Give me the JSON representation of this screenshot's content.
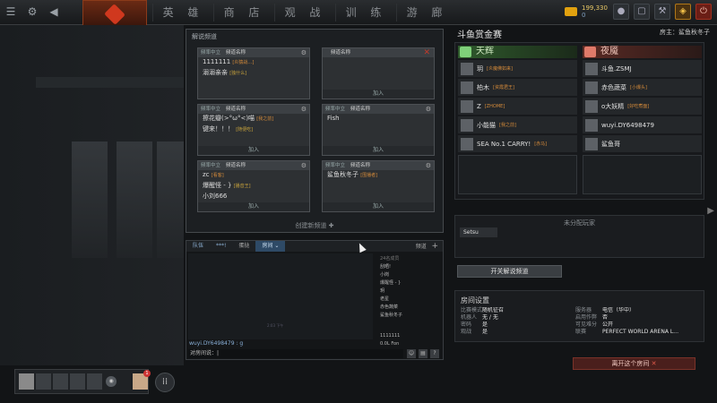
{
  "nav": {
    "items": [
      "英 雄",
      "商 店",
      "观 战",
      "训 练",
      "游 廊"
    ]
  },
  "top": {
    "gold": "199,330",
    "gold_sub": "0"
  },
  "channels": {
    "title": "解说频道",
    "create_label": "创建新频道",
    "cards": [
      {
        "hd1": "频率中立",
        "hd2": "频道名称",
        "lines": [
          {
            "text": "1111111",
            "tag": "[炎猿战…]"
          },
          {
            "text": "溺溺亲亲",
            "tag": "[独什么]"
          }
        ],
        "join": "",
        "icon": "gear"
      },
      {
        "hd1": "",
        "hd2": "频道名称",
        "lines": [],
        "join": "加入",
        "icon": "x"
      },
      {
        "hd1": "频率中立",
        "hd2": "频道名称",
        "lines": [
          {
            "text": "擦花瓣(>°ω°<)喵",
            "tag": "[我之前]"
          },
          {
            "text": "键来！！！",
            "tag": "[随便吃]"
          }
        ],
        "join": "加入",
        "icon": "gear"
      },
      {
        "hd1": "频率中立",
        "hd2": "频道名称",
        "lines": [
          {
            "text": "Fish",
            "tag": ""
          }
        ],
        "join": "加入",
        "icon": "gear"
      },
      {
        "hd1": "频率中立",
        "hd2": "频道名称",
        "lines": [
          {
            "text": "zc",
            "tag": "[看客]"
          },
          {
            "text": "爆醒怪 - }",
            "tag": "[播音王]"
          },
          {
            "text": "小刘666",
            "tag": ""
          }
        ],
        "join": "加入",
        "icon": "gear"
      },
      {
        "hd1": "频率中立",
        "hd2": "频道名称",
        "lines": [
          {
            "text": "鲨鱼秋冬子",
            "tag": "[围播者]"
          }
        ],
        "join": "加入",
        "icon": "gear"
      }
    ]
  },
  "chat": {
    "tabs": [
      "队伍",
      "***!",
      "蛋挞",
      "房间"
    ],
    "channel_label": "频道",
    "members_header": "24名成员",
    "members": [
      "刮晒!",
      "小岗",
      "爆醒怪 - }",
      "玥",
      "老星",
      "赤色蔬菜",
      "鲨鱼秋冬子"
    ],
    "members2": [
      "1111111",
      "0.0L Fon"
    ],
    "time": "2:03 下午",
    "user": "wuyi.DY6498479 : g",
    "input_label": "对房间说："
  },
  "room": {
    "title": "斗鱼赏金赛",
    "owner": "房主：鲨鱼秋冬子",
    "radiant": {
      "name": "天辉",
      "players": [
        {
          "name": "玥",
          "tag": "[炎魔佛如来]"
        },
        {
          "name": "柏木",
          "tag": "[资霞君王]"
        },
        {
          "name": "Z",
          "tag": "[ZHOME]"
        },
        {
          "name": "小能猫",
          "tag": "[我之前]"
        },
        {
          "name": "SEA No.1 CARRY!",
          "tag": "[赤马]"
        }
      ]
    },
    "dire": {
      "name": "夜魇",
      "players": [
        {
          "name": "斗鱼.ZSMJ",
          "tag": ""
        },
        {
          "name": "赤色蔬菜",
          "tag": "[小爆头]"
        },
        {
          "name": "o大妖精",
          "tag": "[好吃煮面]"
        },
        {
          "name": "wuyi.DY6498479",
          "tag": ""
        },
        {
          "name": "鲨鱼哥",
          "tag": ""
        }
      ]
    },
    "unassigned_title": "未分配玩家",
    "unassigned": [
      "Setsu"
    ],
    "toggle_label": "开关解说频道",
    "settings": {
      "title": "房间设置",
      "rows": [
        {
          "k1": "比赛模式",
          "v1": "随机征召",
          "k2": "服务器",
          "v2": "电信（华中）"
        },
        {
          "k1": "机器人",
          "v1": "无 / 无",
          "k2": "启用作弊",
          "v2": "否"
        },
        {
          "k1": "密码",
          "v1": "是",
          "k2": "可见难分",
          "v2": "公开"
        },
        {
          "k1": "观战",
          "v1": "是",
          "k2": "联赛",
          "v2": "PERFECT WORLD ARENA L…"
        }
      ]
    },
    "leave_label": "离开这个房间"
  },
  "party": {
    "badge": "1"
  }
}
